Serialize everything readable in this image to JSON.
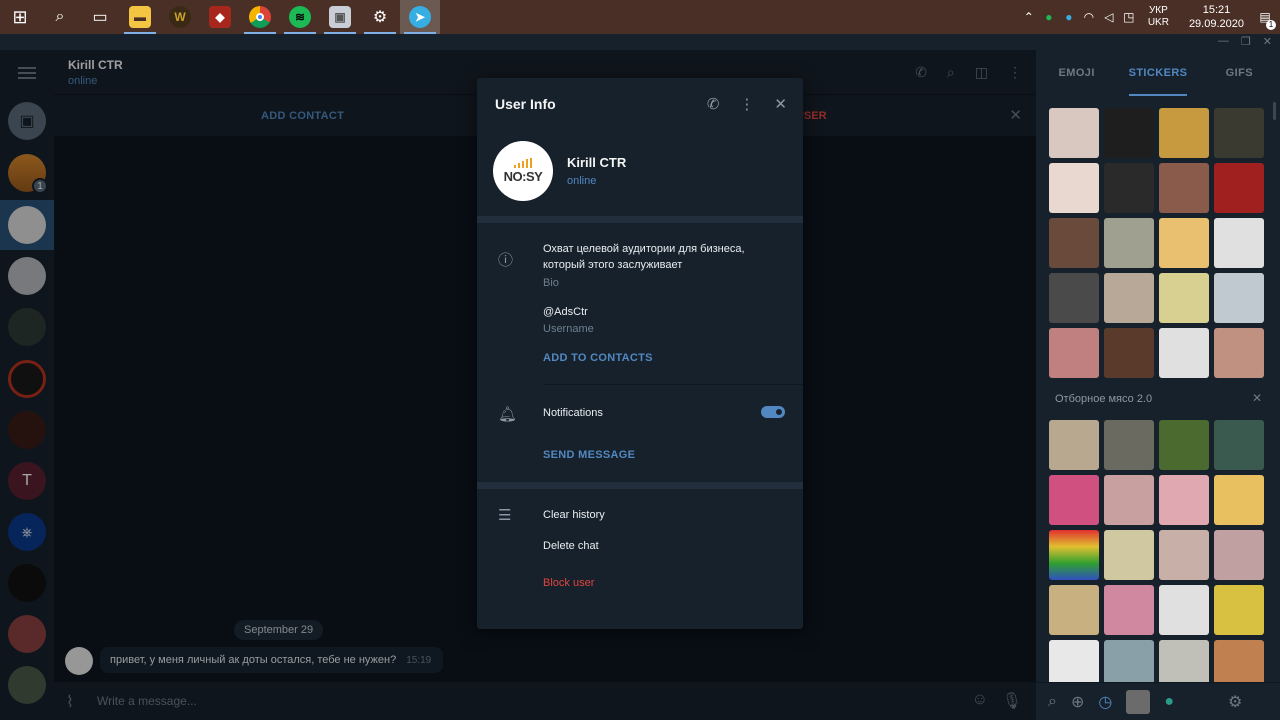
{
  "taskbar": {
    "apps": [
      {
        "name": "start",
        "glyph": "⊞",
        "color": "#ffffff"
      },
      {
        "name": "search",
        "glyph": "⌕",
        "color": "#ffffff"
      },
      {
        "name": "task-view",
        "glyph": "▭",
        "color": "#ffffff"
      },
      {
        "name": "file-explorer",
        "glyph": "▬",
        "color": "#f4c542"
      },
      {
        "name": "world-of-warcraft",
        "glyph": "W",
        "color": "#c9a227"
      },
      {
        "name": "dota",
        "glyph": "◆",
        "color": "#c23c2a"
      },
      {
        "name": "chrome",
        "glyph": "◉",
        "color": "#e5b92e"
      },
      {
        "name": "spotify",
        "glyph": "≋",
        "color": "#1db954"
      },
      {
        "name": "app-window",
        "glyph": "▣",
        "color": "#c9ced6"
      },
      {
        "name": "settings",
        "glyph": "⚙",
        "color": "#ffffff"
      },
      {
        "name": "telegram",
        "glyph": "➤",
        "color": "#37aee2"
      }
    ],
    "lang_top": "УКР",
    "lang_bottom": "UKR",
    "time": "15:21",
    "date": "29.09.2020",
    "notif_count": "1"
  },
  "chat": {
    "name": "Kirill CTR",
    "status": "online",
    "add_contact": "ADD CONTACT",
    "report": "USER",
    "date_pill": "September 29",
    "message": "привет, у меня личный ак доты остался, тебе не нужен?",
    "message_time": "15:19",
    "input_placeholder": "Write a message..."
  },
  "sidebar": {
    "unread_badge": "1"
  },
  "stickers": {
    "tabs": [
      "EMOJI",
      "STICKERS",
      "GIFS"
    ],
    "pack_title": "Отборное мясо 2.0"
  },
  "modal": {
    "title": "User Info",
    "name": "Kirill CTR",
    "status": "online",
    "avatar_logo": "NO:SY",
    "bio": "Охват целевой аудитории для бизнеса, который этого заслуживает",
    "bio_label": "Bio",
    "username": "@AdsCtr",
    "username_label": "Username",
    "add_to_contacts": "ADD TO CONTACTS",
    "notifications": "Notifications",
    "notifications_on": true,
    "send_message": "SEND MESSAGE",
    "clear_history": "Clear history",
    "delete_chat": "Delete chat",
    "block_user": "Block user"
  }
}
